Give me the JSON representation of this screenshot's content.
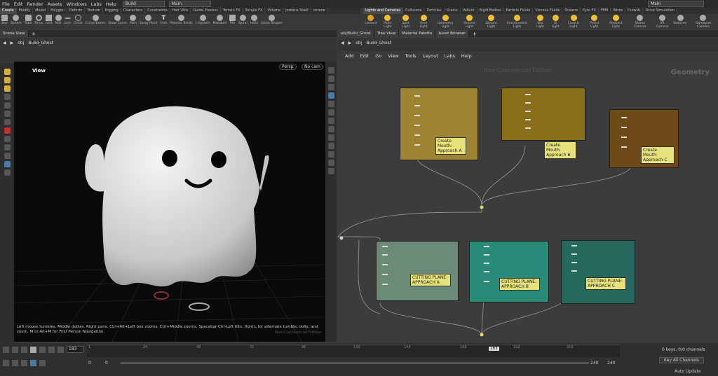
{
  "menu": [
    "File",
    "Edit",
    "Render",
    "Assets",
    "Windows",
    "Labs",
    "Help"
  ],
  "desktop": "Build",
  "context": "Main",
  "context_right": "Main",
  "shelf_tabs_left": [
    "Create",
    "Modify",
    "Model",
    "Polygon",
    "Deform",
    "Texture",
    "Rigging",
    "Characters",
    "Constraints",
    "Hair Utils",
    "Guide Process",
    "Terrain FX",
    "Simple FX",
    "Volume",
    "Jordans Shelf",
    "octane"
  ],
  "shelf_tabs_right": [
    "Lights and Cameras",
    "Collisions",
    "Particles",
    "Grains",
    "Vellum",
    "Rigid Bodies",
    "Particle Fluids",
    "Viscous Fluids",
    "Oceans",
    "Pyro FX",
    "FEM",
    "Wires",
    "Crowds",
    "Drive Simulation"
  ],
  "tools_left": [
    "Box",
    "Sphere",
    "Tube",
    "Torus",
    "Grid",
    "Null",
    "Line",
    "Circle",
    "Curve Bezier",
    "Draw Curve",
    "Path",
    "Spray Paint",
    "Font",
    "Platonic Solids",
    "L-System",
    "Metaball",
    "File",
    "Spiral",
    "Helix",
    "Quick Shapes"
  ],
  "tools_right": [
    "Camera",
    "Point Light",
    "Spot Light",
    "Area Light",
    "Geometry Light",
    "Volume Light",
    "Distant Light",
    "Environment Light",
    "Sky Light",
    "GI Light",
    "Caustic Light",
    "Portal Light",
    "Ambient Light",
    "Stereo Camera",
    "VR Camera",
    "Switcher",
    "Gamepad Camera"
  ],
  "left_pane_tab": "Scene View",
  "right_pane_tabs": [
    "obj/Build_Ghost",
    "Tree View",
    "Material Palette",
    "Asset Browser"
  ],
  "path": {
    "root": "obj",
    "node": "Build_Ghost"
  },
  "viewport": {
    "title": "View",
    "persp": "Persp",
    "cam": "No cam",
    "help": "Left mouse tumbles. Middle dollies. Right pans. Ctrl+Alt+Left box zooms. Ctrl+Middle zooms. Spacebar-Ctrl-Left tilts. Hold L for alternate tumble, dolly, and zoom. M or Alt+M for First Person Navigation.",
    "watermark": "Non-Commercial Edition"
  },
  "network_menu": [
    "Add",
    "Edit",
    "Go",
    "View",
    "Tools",
    "Layout",
    "Labs",
    "Help"
  ],
  "network": {
    "watermark": "Non-Commercial Edition",
    "context": "Geometry"
  },
  "nodes": [
    {
      "label": "Create Mouth: Approach A",
      "color": "#9c8433"
    },
    {
      "label": "Create Mouth: Approach B",
      "color": "#8a6d18"
    },
    {
      "label": "Create Mouth: Approach C",
      "color": "#6e4a18"
    },
    {
      "label": "CUTTING PLANE: APPROACH A",
      "color": "#6b8b78"
    },
    {
      "label": "CUTTING PLANE: APPROACH B",
      "color": "#2a8a78"
    },
    {
      "label": "CUTTING PLANE: APPROACH C",
      "color": "#25685e"
    }
  ],
  "timeline": {
    "frame": "183",
    "ticks": [
      "1",
      "24",
      "48",
      "72",
      "96",
      "120",
      "144",
      "168",
      "192",
      "216"
    ],
    "start": "0",
    "start2": "0",
    "end": "240",
    "end2": "240",
    "keys": "0 keys, 0/0 channels",
    "key_all": "Key All Channels",
    "auto_update": "Auto Update"
  }
}
